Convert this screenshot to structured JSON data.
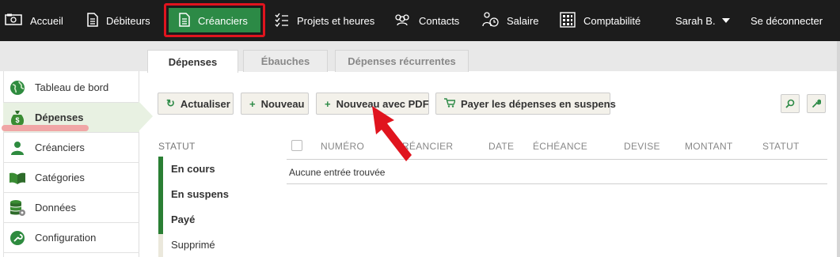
{
  "nav": {
    "items": [
      {
        "label": "Accueil",
        "icon": "home-icon"
      },
      {
        "label": "Débiteurs",
        "icon": "document-icon"
      },
      {
        "label": "Créanciers",
        "icon": "document-icon",
        "active": true
      },
      {
        "label": "Projets et heures",
        "icon": "checklist-icon"
      },
      {
        "label": "Contacts",
        "icon": "people-icon"
      },
      {
        "label": "Salaire",
        "icon": "payroll-icon"
      },
      {
        "label": "Comptabilité",
        "icon": "calculator-icon"
      }
    ],
    "user": "Sarah B.",
    "logout": "Se déconnecter"
  },
  "tabs": [
    {
      "label": "Dépenses",
      "active": true
    },
    {
      "label": "Ébauches"
    },
    {
      "label": "Dépenses récurrentes"
    }
  ],
  "sidebar": {
    "items": [
      {
        "label": "Tableau de bord",
        "icon": "globe-icon"
      },
      {
        "label": "Dépenses",
        "icon": "money-bag-icon",
        "active": true
      },
      {
        "label": "Créanciers",
        "icon": "person-icon"
      },
      {
        "label": "Catégories",
        "icon": "book-icon"
      },
      {
        "label": "Données",
        "icon": "database-icon"
      },
      {
        "label": "Configuration",
        "icon": "wrench-icon"
      }
    ]
  },
  "toolbar": {
    "refresh": "Actualiser",
    "new": "Nouveau",
    "new_pdf": "Nouveau avec PDF",
    "pay_pending": "Payer les dépenses en suspens"
  },
  "filters": {
    "title": "STATUT",
    "items": [
      "En cours",
      "En suspens",
      "Payé",
      "Supprimé"
    ]
  },
  "table": {
    "columns": [
      "NUMÉRO",
      "CRÉANCIER",
      "DATE",
      "ÉCHÉANCE",
      "DEVISE",
      "MONTANT",
      "STATUT"
    ],
    "empty_message": "Aucune entrée trouvée"
  },
  "colors": {
    "nav_bg": "#1c1c1c",
    "active_green": "#2c8a46",
    "highlight_red": "#e0141e",
    "sidebar_active": "#e8f1e2"
  }
}
